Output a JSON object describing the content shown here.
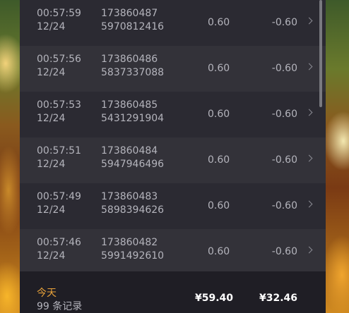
{
  "records": [
    {
      "time": "00:57:59",
      "date": "12/24",
      "id_line1": "173860487",
      "id_line2": "5970812416",
      "bet": "0.60",
      "win": "-0.60"
    },
    {
      "time": "00:57:56",
      "date": "12/24",
      "id_line1": "173860486",
      "id_line2": "5837337088",
      "bet": "0.60",
      "win": "-0.60"
    },
    {
      "time": "00:57:53",
      "date": "12/24",
      "id_line1": "173860485",
      "id_line2": "5431291904",
      "bet": "0.60",
      "win": "-0.60"
    },
    {
      "time": "00:57:51",
      "date": "12/24",
      "id_line1": "173860484",
      "id_line2": "5947946496",
      "bet": "0.60",
      "win": "-0.60"
    },
    {
      "time": "00:57:49",
      "date": "12/24",
      "id_line1": "173860483",
      "id_line2": "5898394626",
      "bet": "0.60",
      "win": "-0.60"
    },
    {
      "time": "00:57:46",
      "date": "12/24",
      "id_line1": "173860482",
      "id_line2": "5991492610",
      "bet": "0.60",
      "win": "-0.60"
    }
  ],
  "footer": {
    "today_label": "今天",
    "count_label": "99 条记录",
    "total_bet": "¥59.40",
    "total_win": "¥32.46"
  },
  "colors": {
    "accent": "#e8a23a",
    "panel": "#26252d",
    "row_odd": "#2b2a32",
    "row_even": "#333239"
  },
  "icons": {
    "row_arrow": "chevron-right-icon"
  }
}
